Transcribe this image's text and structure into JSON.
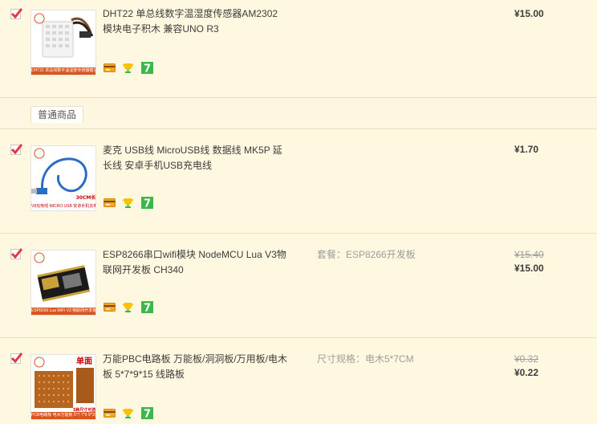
{
  "group": {
    "label": "普通商品"
  },
  "items": [
    {
      "title": "DHT22 单总线数字温湿度传感器AM2302模块电子积木 兼容UNO R3",
      "thumb_caption": "DHT22 单总线数字温湿度传感器模块",
      "sku": "",
      "original_price": "",
      "price": "¥15.00",
      "checked": true
    },
    {
      "title": "麦克 USB线 MicroUSB线 数据线 MK5P 延长线 安卓手机USB充电线",
      "thumb_caption": "V8充电线 MICRO USB 安卓手机充电线 MK5P",
      "thumb_note": "30CM长",
      "sku": "",
      "original_price": "",
      "price": "¥1.70",
      "checked": true
    },
    {
      "title": "ESP8266串口wifi模块 NodeMCU Lua V3物联网开发板 CH340",
      "thumb_caption": "ESP8266 Lua WiFi V3 物联网开发板 CH340",
      "sku": "套餐：ESP8266开发板",
      "original_price": "¥15.40",
      "price": "¥15.00",
      "checked": true
    },
    {
      "title": "万能PBC电路板 万能板/洞洞板/万用板/电木板 5*7*9*15 线路板",
      "thumb_caption": "PCB电路板 电木万能板 5*7 7*9 9*15",
      "thumb_note": "3种尺寸可选",
      "thumb_heading": "单面",
      "sku": "尺寸规格：电木5*7CM",
      "original_price": "¥0.32",
      "price": "¥0.22",
      "checked": true
    }
  ],
  "badge_icons": [
    "credit-card-icon",
    "trophy-icon",
    "seven-day-return-icon"
  ],
  "colors": {
    "accent": "#e4393c",
    "price": "#3c3c3c",
    "badge_green": "#3db64a",
    "badge_orange": "#f6a623",
    "thumb_caption": "#d9541e"
  }
}
